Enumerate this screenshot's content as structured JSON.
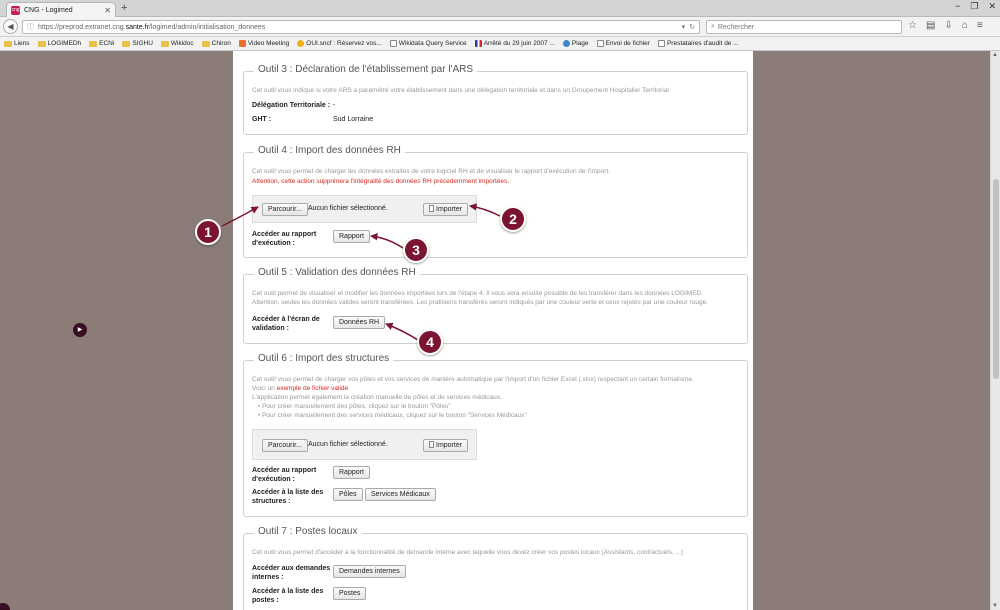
{
  "browser": {
    "tab_title": "CNG - Logimed",
    "favicon_text": "cng",
    "new_tab": "+",
    "window_controls": [
      "−",
      "❐",
      "✕"
    ],
    "url_prefix": "https://preprod.extranet.cng.",
    "url_host": "sante.fr",
    "url_path": "/logimed/admin/initialisation_donnees",
    "search_placeholder": "Rechercher",
    "bookmarks": [
      {
        "label": "Liens",
        "icon": "folder"
      },
      {
        "label": "LOGIMEDh",
        "icon": "folder"
      },
      {
        "label": "ECNi",
        "icon": "folder"
      },
      {
        "label": "SIGHU",
        "icon": "folder"
      },
      {
        "label": "Wikidoc",
        "icon": "folder"
      },
      {
        "label": "Chiron",
        "icon": "folder"
      },
      {
        "label": "Video Meeting",
        "icon": "video"
      },
      {
        "label": "OUI.sncf : Réservez vos...",
        "icon": "sncf"
      },
      {
        "label": "Wikidata Query Service",
        "icon": "page"
      },
      {
        "label": "Arrêté du 29 juin 2007 ...",
        "icon": "flag"
      },
      {
        "label": "Plage",
        "icon": "globe"
      },
      {
        "label": "Envoi de fichier",
        "icon": "page"
      },
      {
        "label": "Prestataires d'audit de ...",
        "icon": "page"
      }
    ]
  },
  "outil3": {
    "title": "Outil 3 : Déclaration de l'établissement par l'ARS",
    "desc": "Cet outil vous indique si votre ARS a paramétré votre établissement dans une délégation territoriale et dans un Groupement Hospitalier Territorial",
    "dt_label": "Délégation Territoriale :",
    "dt_value": "-",
    "ght_label": "GHT :",
    "ght_value": "Sud Lorraine"
  },
  "outil4": {
    "title": "Outil 4 : Import des données RH",
    "desc": "Cet outil vous permet de charger les données extraites de votre logiciel RH et de visualiser le rapport d'exécution de l'import.",
    "warning": "Attention, cette action supprimera l'intégralité des données RH précedemment importées.",
    "browse_label": "Parcourir...",
    "file_status": "Aucun fichier sélectionné.",
    "import_label": "Importer",
    "rapport_label_1": "Accéder au rapport",
    "rapport_label_2": "d'exécution :",
    "rapport_button": "Rapport"
  },
  "outil5": {
    "title": "Outil 5 : Validation des données RH",
    "desc_1": "Cet outil permet de visualiser et modifier les données importées lors de l'étape 4. Il vous sera ensuite possible de les transférer dans les données LOGIMED.",
    "desc_2": "Attention, seules les données valides seront transférées. Les praticiens transférés seront indiqués par une couleur verte et ceux rejetés par une couleur rouge.",
    "label_1": "Accéder à l'écran de",
    "label_2": "validation :",
    "button": "Données RH"
  },
  "outil6": {
    "title": "Outil 6 : Import des structures",
    "desc_1": "Cet outil vous permet de charger vos pôles et vos services de manière automatique par l'import d'un fichier Excel (.xlsx) respectant un certain formalisme.",
    "desc_2_prefix": "Voici un ",
    "desc_2_link": "exemple de fichier valide",
    "desc_3": "L'application permet également la création manuelle de pôles et de services médicaux.",
    "bullet_1": "Pour créer manuellement des pôles, cliquez sur le bouton \"Pôles\"",
    "bullet_2": "Pour créer manuellement des services médicaux, cliquez sur le bouton \"Services Médicaux\"",
    "browse_label": "Parcourir...",
    "file_status": "Aucun fichier sélectionné.",
    "import_label": "Importer",
    "rapport_label_1": "Accéder au rapport",
    "rapport_label_2": "d'exécution :",
    "rapport_button": "Rapport",
    "structures_label_1": "Accéder à la liste des",
    "structures_label_2": "structures :",
    "poles_button": "Pôles",
    "services_button": "Services Médicaux"
  },
  "outil7": {
    "title": "Outil 7 : Postes locaux",
    "desc": "Cet outil vous permet d'accéder à la fonctionnalité de demande interne avec laquelle vous devez créer vos postes locaux (Assistants, contractuels, ...)",
    "demandes_label_1": "Accéder aux demandes",
    "demandes_label_2": "internes :",
    "demandes_button": "Demandes internes",
    "postes_label_1": "Accéder à la liste des",
    "postes_label_2": "postes :",
    "postes_button": "Postes"
  },
  "callouts": [
    "1",
    "2",
    "3",
    "4"
  ],
  "colors": {
    "callout": "#7a1430",
    "warning": "#d9261c",
    "background": "#8b7c77"
  }
}
